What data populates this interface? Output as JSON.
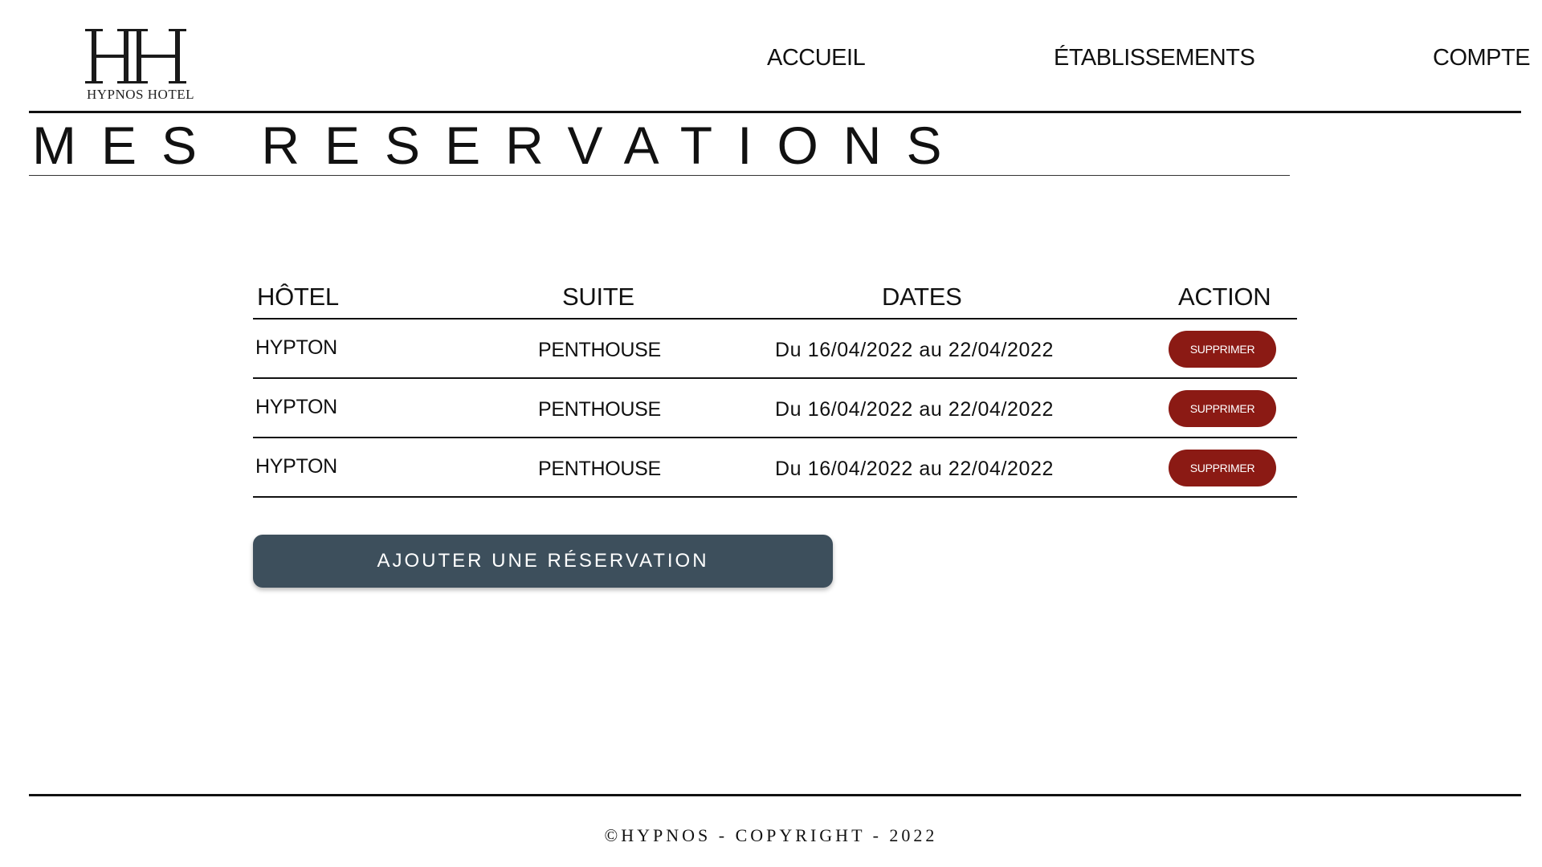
{
  "brand": {
    "logo_letters": "HH",
    "name": "HYPNOS HOTEL"
  },
  "nav": {
    "items": [
      {
        "label": "ACCUEIL"
      },
      {
        "label": "ÉTABLISSEMENTS"
      },
      {
        "label": "COMPTE"
      }
    ]
  },
  "page": {
    "title": "MES RESERVATIONS"
  },
  "table": {
    "headers": {
      "hotel": "HÔTEL",
      "suite": "SUITE",
      "dates": "DATES",
      "action": "ACTION"
    },
    "rows": [
      {
        "hotel": "HYPTON",
        "suite": "PENTHOUSE",
        "dates": "Du 16/04/2022 au 22/04/2022",
        "action_label": "SUPPRIMER"
      },
      {
        "hotel": "HYPTON",
        "suite": "PENTHOUSE",
        "dates": "Du 16/04/2022 au 22/04/2022",
        "action_label": "SUPPRIMER"
      },
      {
        "hotel": "HYPTON",
        "suite": "PENTHOUSE",
        "dates": "Du 16/04/2022 au 22/04/2022",
        "action_label": "SUPPRIMER"
      }
    ]
  },
  "add_button": {
    "label": "AJOUTER UNE RÉSERVATION"
  },
  "footer": {
    "text": "©HYPNOS - COPYRIGHT - 2022"
  },
  "colors": {
    "delete_button": "#8b1a14",
    "add_button": "#3d4f5c",
    "text": "#111111",
    "background": "#ffffff"
  }
}
